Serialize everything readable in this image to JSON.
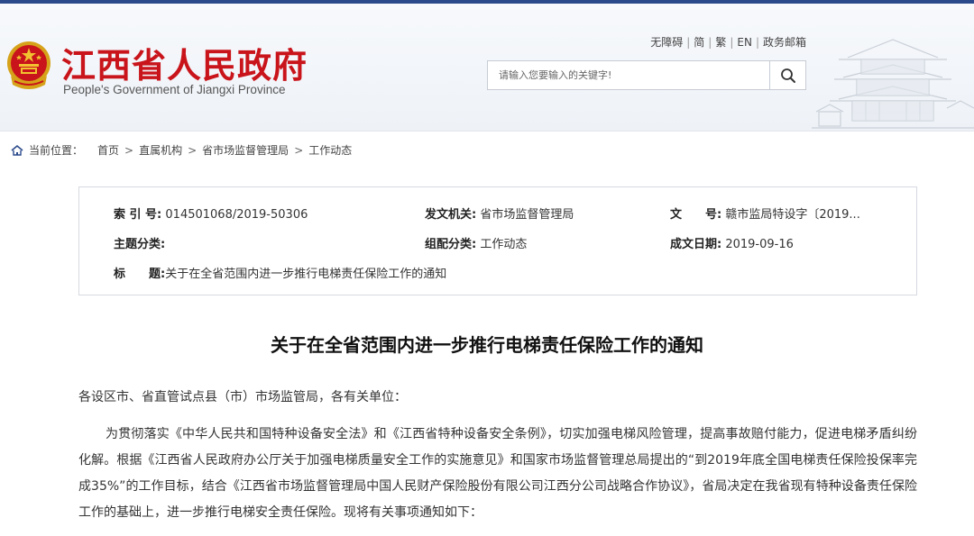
{
  "header": {
    "title": "江西省人民政府",
    "subtitle": "People's Government of Jiangxi Province",
    "links": [
      "无障碍",
      "简",
      "繁",
      "EN",
      "政务邮箱"
    ],
    "search_placeholder": "请输入您要输入的关键字!"
  },
  "breadcrumb": {
    "label": "当前位置：",
    "items": [
      "首页",
      "直属机构",
      "省市场监督管理局",
      "工作动态"
    ]
  },
  "meta": {
    "index_label": "索 引 号:",
    "index_value": "014501068/2019-50306",
    "issuer_label": "发文机关:",
    "issuer_value": "省市场监督管理局",
    "docno_label": "文　　号:",
    "docno_value": "赣市监局特设字〔2019...",
    "subject_label": "主题分类:",
    "subject_value": "",
    "category_label": "组配分类:",
    "category_value": "工作动态",
    "date_label": "成文日期:",
    "date_value": "2019-09-16",
    "title_label": "标　　题:",
    "title_value": "关于在全省范围内进一步推行电梯责任保险工作的通知"
  },
  "article": {
    "title": "关于在全省范围内进一步推行电梯责任保险工作的通知",
    "salutation": "各设区市、省直管试点县（市）市场监管局，各有关单位：",
    "paragraph": "为贯彻落实《中华人民共和国特种设备安全法》和《江西省特种设备安全条例》，切实加强电梯风险管理，提高事故赔付能力，促进电梯矛盾纠纷化解。根据《江西省人民政府办公厅关于加强电梯质量安全工作的实施意见》和国家市场监督管理总局提出的“到2019年底全国电梯责任保险投保率完成35%”的工作目标，结合《江西省市场监督管理局中国人民财产保险股份有限公司江西分公司战略合作协议》，省局决定在我省现有特种设备责任保险工作的基础上，进一步推行电梯安全责任保险。现将有关事项通知如下："
  },
  "colors": {
    "brand_red": "#c8141a",
    "topbar": "#2b4a8b"
  },
  "icons": [
    "national-emblem-icon",
    "search-icon",
    "home-icon",
    "pagoda-illustration"
  ]
}
